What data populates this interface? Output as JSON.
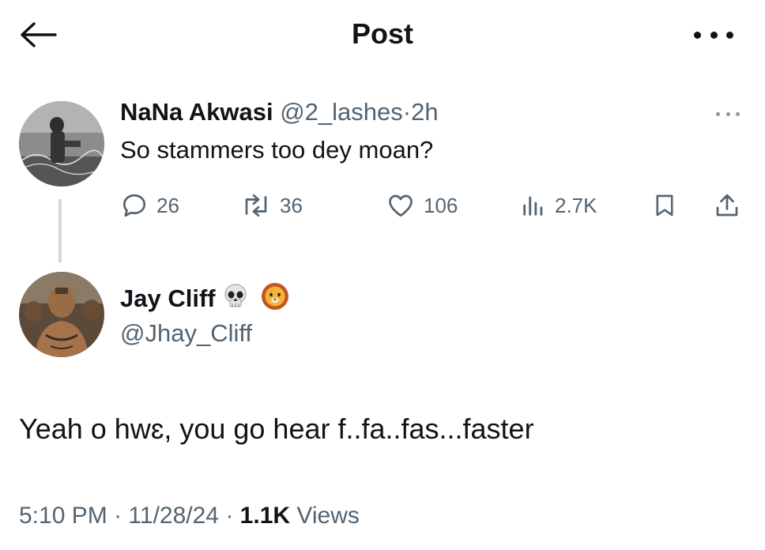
{
  "header": {
    "title": "Post",
    "back_icon": "arrow-left-icon",
    "more_icon": "more-horizontal-icon"
  },
  "parent": {
    "name": "NaNa Akwasi",
    "handle": "@2_lashes",
    "separator": "·",
    "time": "2h",
    "text": "So stammers too dey moan?",
    "actions": {
      "replies": "26",
      "reposts": "36",
      "likes": "106",
      "views": "2.7K"
    }
  },
  "tweet": {
    "name": "Jay Cliff",
    "emojis": [
      "skull-emoji",
      "lion-emoji"
    ],
    "handle": "@Jhay_Cliff",
    "text": "Yeah o hwɛ, you go hear f..fa..fas...faster",
    "time": "5:10 PM",
    "sep1": "·",
    "date": "11/28/24",
    "sep2": "·",
    "views_count": "1.1K",
    "views_label": "Views"
  },
  "colors": {
    "text": "#0f1419",
    "secondary": "#536471",
    "thread_line": "#cfd9de"
  }
}
